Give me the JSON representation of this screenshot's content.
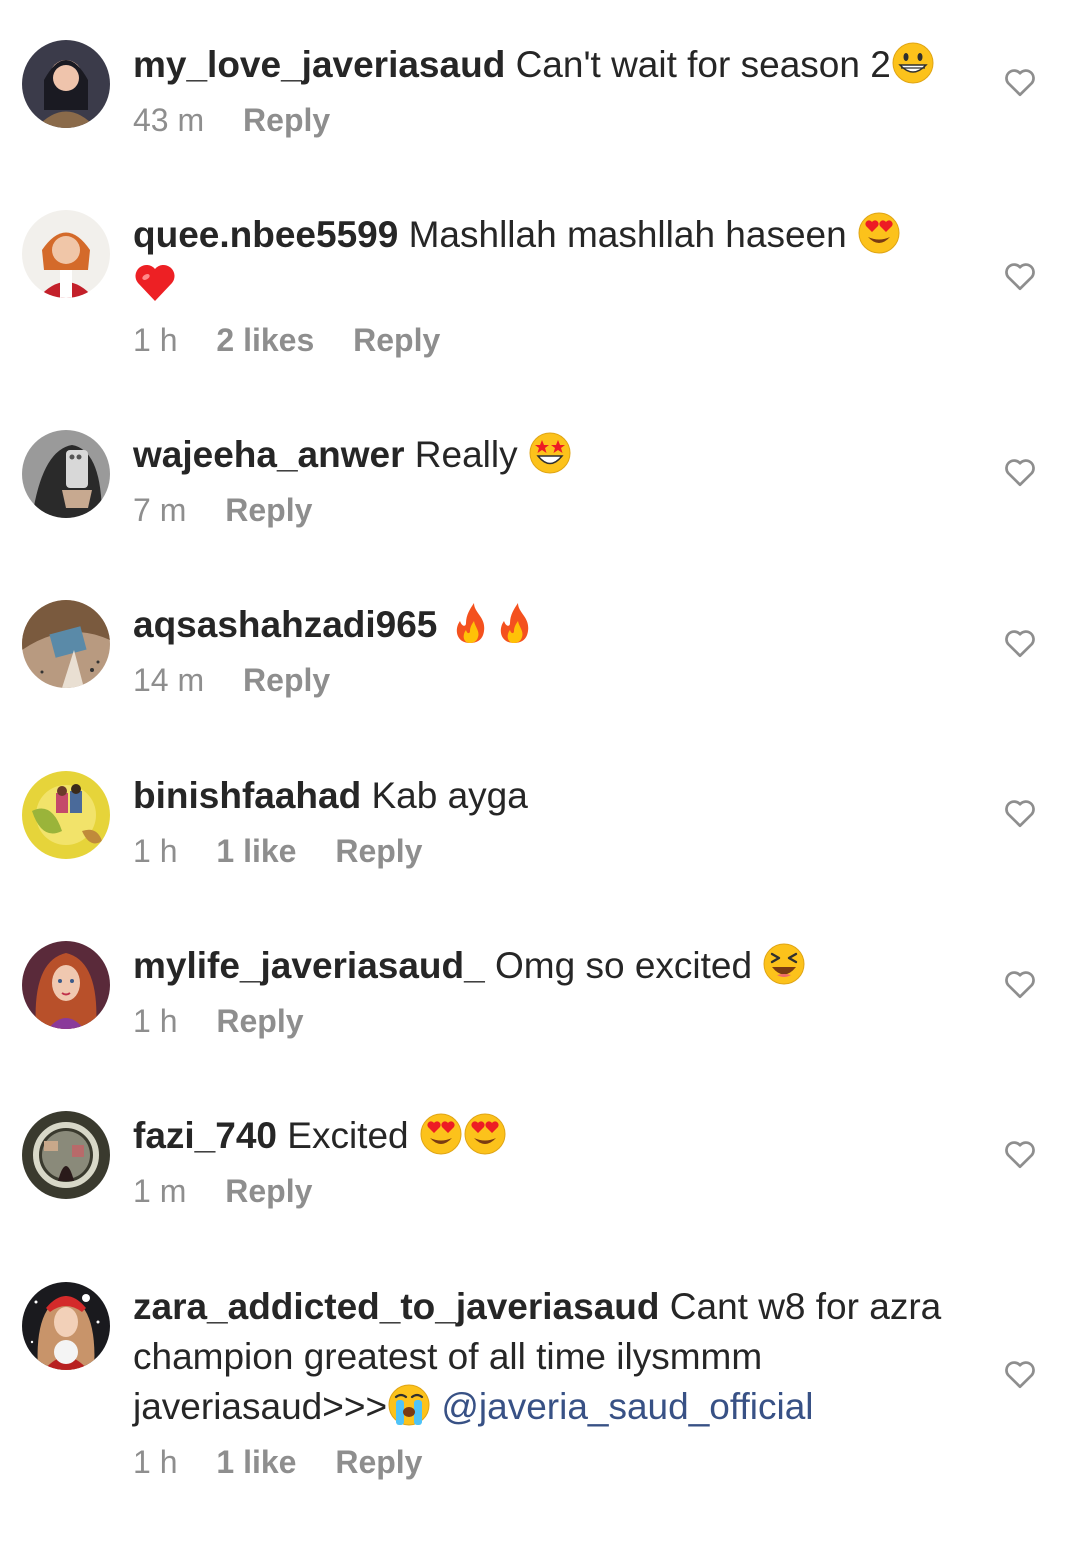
{
  "comments": [
    {
      "username": "my_love_javeriasaud",
      "text": "Can't wait for season 2",
      "emoji_after": [
        "grinning-face"
      ],
      "time": "43 m",
      "likes": "",
      "reply": "Reply"
    },
    {
      "username": "quee.nbee5599",
      "text": "Mashllah mashllah haseen",
      "emoji_after": [
        "heart-eyes-face",
        "red-heart"
      ],
      "time": "1 h",
      "likes": "2 likes",
      "reply": "Reply"
    },
    {
      "username": "wajeeha_anwer",
      "text": "Really",
      "emoji_after": [
        "star-struck-face"
      ],
      "time": "7 m",
      "likes": "",
      "reply": "Reply"
    },
    {
      "username": "aqsashahzadi965",
      "text": "",
      "emoji_after": [
        "fire",
        "fire"
      ],
      "time": "14 m",
      "likes": "",
      "reply": "Reply"
    },
    {
      "username": "binishfaahad",
      "text": "Kab ayga",
      "emoji_after": [],
      "time": "1 h",
      "likes": "1 like",
      "reply": "Reply"
    },
    {
      "username": "mylife_javeriasaud_",
      "text": "Omg so excited",
      "emoji_after": [
        "squinting-laughing-face"
      ],
      "time": "1 h",
      "likes": "",
      "reply": "Reply"
    },
    {
      "username": "fazi_740",
      "text": "Excited",
      "emoji_after": [
        "heart-eyes-face",
        "heart-eyes-face"
      ],
      "time": "1 m",
      "likes": "",
      "reply": "Reply"
    },
    {
      "username": "zara_addicted_to_javeriasaud",
      "text": "Cant w8 for azra champion greatest of all time ilysmmm javeriasaud>>>",
      "emoji_after": [
        "crying-face"
      ],
      "mention": "@javeria_saud_official",
      "time": "1 h",
      "likes": "1 like",
      "reply": "Reply"
    }
  ],
  "icons": {
    "like": "heart-outline-icon"
  },
  "colors": {
    "text": "#262626",
    "meta": "#8e8e8e",
    "mention": "#385185",
    "heart_stroke": "#8e8e8e"
  }
}
